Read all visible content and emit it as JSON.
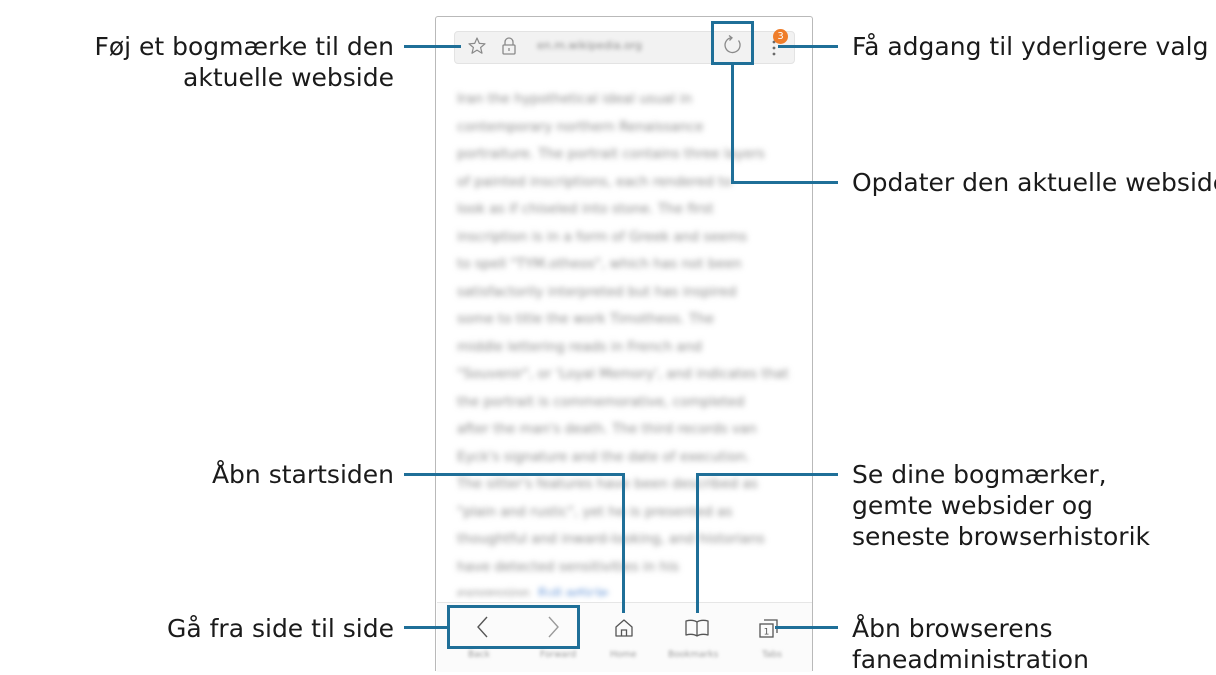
{
  "callouts": {
    "bookmark": "Føj et bogmærke til den aktuelle webside",
    "options": "Få adgang til yderligere valg",
    "refresh": "Opdater den aktuelle webside",
    "home": "Åbn startsiden",
    "bookmarks": "Se dine bogmærker, gemte websider og seneste browserhistorik",
    "navigate": "Gå fra side til side",
    "tabs": "Åbn browserens faneadministration"
  },
  "browser": {
    "badge_count": "3",
    "tab_count": "1",
    "icons": {
      "star": "star-icon",
      "lock": "lock-icon",
      "refresh": "refresh-icon",
      "more": "more-options-icon",
      "back": "back-arrow-icon",
      "forward": "forward-arrow-icon",
      "home": "home-icon",
      "bookmarks": "book-icon",
      "tabs": "tabs-icon"
    }
  },
  "colors": {
    "callout": "#1f6f98",
    "badge": "#ef7d2a"
  }
}
